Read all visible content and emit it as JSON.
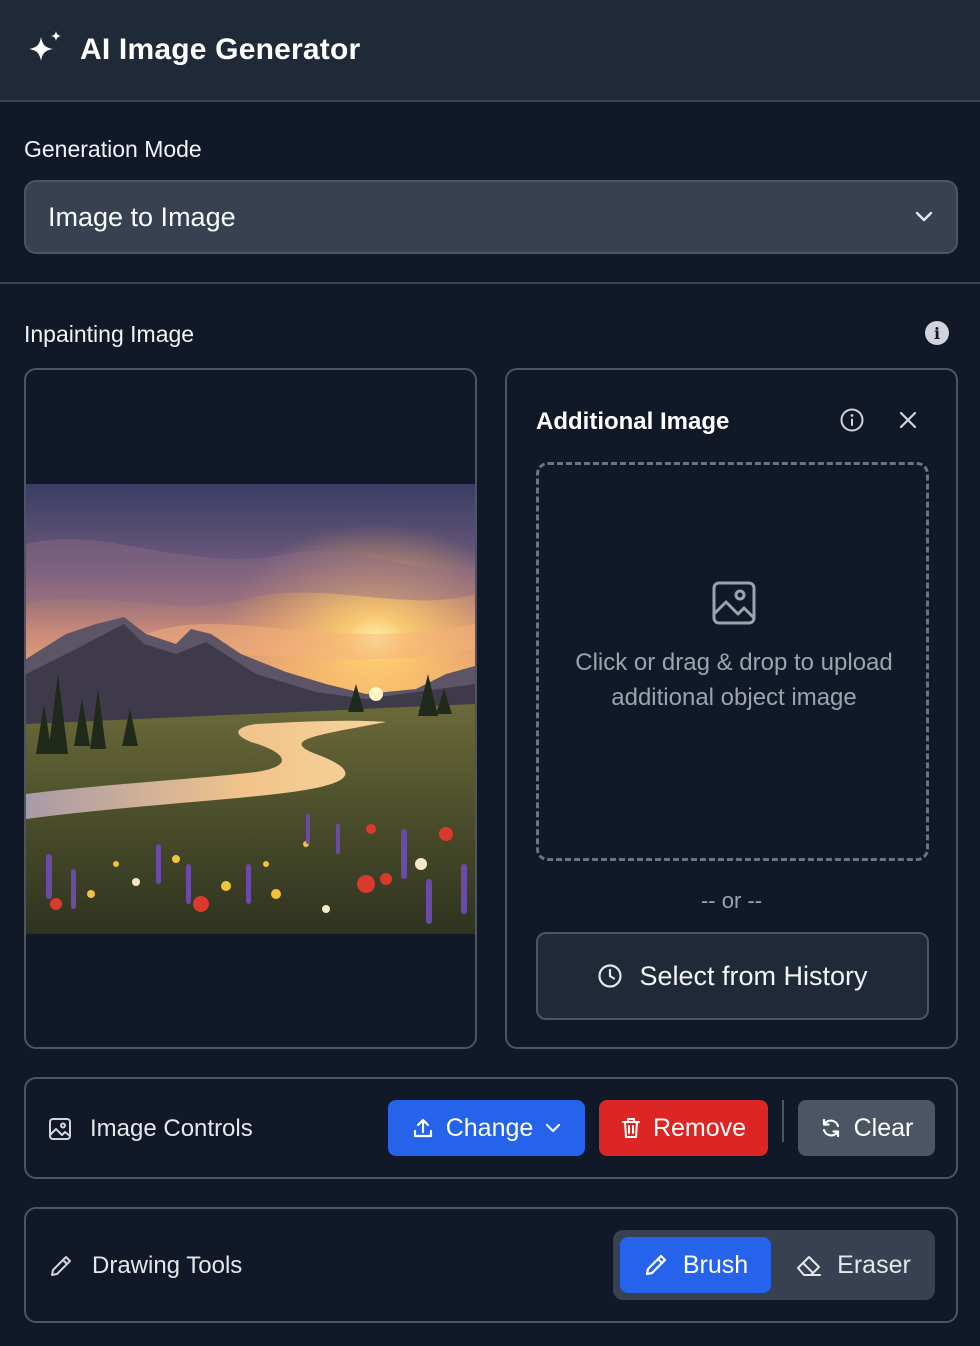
{
  "app": {
    "title": "AI Image Generator",
    "logo_icon": "sparkles-icon"
  },
  "generation_mode": {
    "label": "Generation Mode",
    "selected": "Image to Image"
  },
  "inpainting": {
    "label": "Inpainting Image",
    "info_icon": "info-icon",
    "image_description_icon": "landscape-image"
  },
  "additional_image": {
    "title": "Additional Image",
    "dropzone_text": "Click or drag & drop to upload additional object image",
    "or_text": "-- or --",
    "history_button": "Select from History"
  },
  "image_controls": {
    "label": "Image Controls",
    "change": "Change",
    "remove": "Remove",
    "clear": "Clear"
  },
  "drawing_tools": {
    "label": "Drawing Tools",
    "brush": "Brush",
    "eraser": "Eraser",
    "active_tool": "Brush"
  },
  "colors": {
    "background": "#111827",
    "panel": "#1f2937",
    "accent_blue": "#2563eb",
    "danger_red": "#dc2626",
    "neutral_button": "#4b5563"
  }
}
